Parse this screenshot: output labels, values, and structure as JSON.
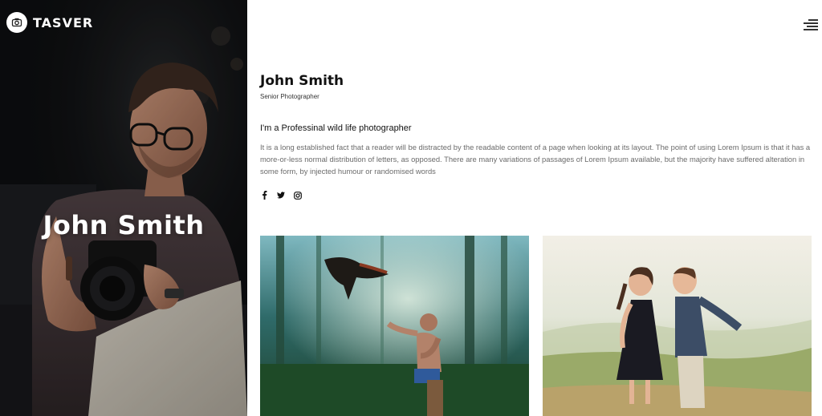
{
  "brand": {
    "name": "TASVER",
    "logo_icon": "camera-icon"
  },
  "hero": {
    "name": "John Smith"
  },
  "header": {
    "menu_icon": "hamburger-menu-icon"
  },
  "profile": {
    "name": "John Smith",
    "role": "Senior Photographer",
    "tagline": "I'm a Professinal wild life photographer",
    "bio": "It is a long established fact that a reader will be distracted by the readable content of a page when looking at its layout. The point of using Lorem Ipsum is that it has a more-or-less normal distribution of letters, as opposed. There are many variations of passages of Lorem Ipsum available, but the majority have suffered alteration in some form, by injected humour or randomised words"
  },
  "socials": [
    {
      "icon": "facebook-icon"
    },
    {
      "icon": "twitter-icon"
    },
    {
      "icon": "instagram-icon"
    }
  ],
  "gallery": [
    {
      "subject": "forest-bird-photo"
    },
    {
      "subject": "children-kiss-photo"
    }
  ],
  "colors": {
    "hero_bg": "#0b0c0d",
    "text_dark": "#111111",
    "text_muted": "#6b6b6b",
    "white": "#ffffff"
  }
}
